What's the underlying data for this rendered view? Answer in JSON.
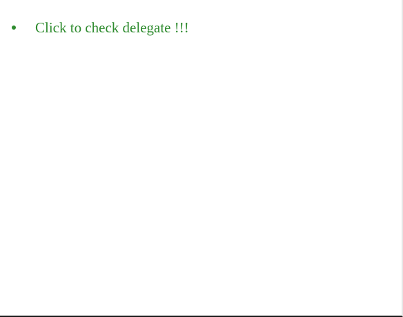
{
  "list": {
    "items": [
      {
        "label": "Click to check delegate !!!"
      }
    ]
  },
  "colors": {
    "text": "#2e8b2e",
    "background": "#ffffff"
  }
}
